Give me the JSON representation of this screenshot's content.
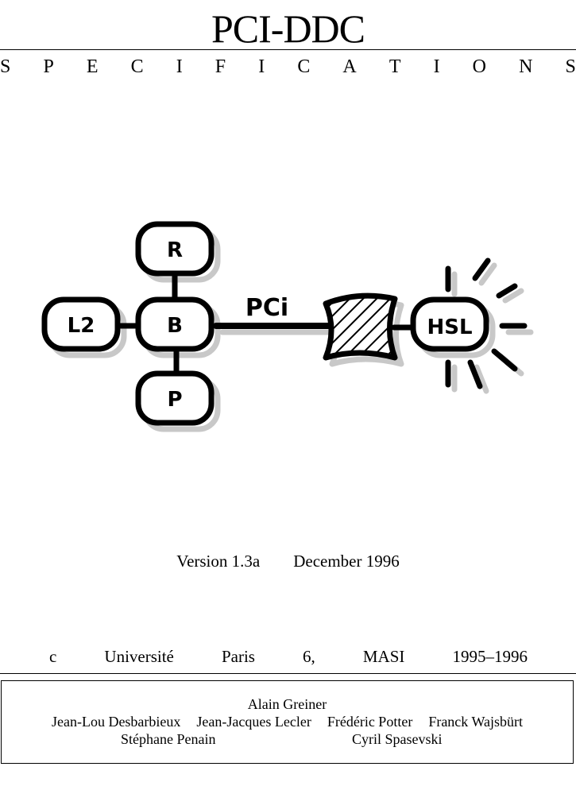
{
  "document": {
    "title": "PCI-DDC",
    "subtitle_letters": [
      "S",
      "P",
      "E",
      "C",
      "I",
      "F",
      "I",
      "C",
      "A",
      "T",
      "I",
      "O",
      "N",
      "S"
    ]
  },
  "diagram": {
    "blocks": [
      {
        "id": "r",
        "label": "R"
      },
      {
        "id": "b",
        "label": "B"
      },
      {
        "id": "l2",
        "label": "L2"
      },
      {
        "id": "p",
        "label": "P"
      },
      {
        "id": "hsl",
        "label": "HSL"
      }
    ],
    "bus_label": "PCi",
    "colors": {
      "stroke": "#000000",
      "shadow": "#c8c8c8",
      "fill": "#ffffff"
    }
  },
  "version": {
    "label": "Version 1.3a",
    "date": "December 1996"
  },
  "copyright": {
    "words": [
      "c",
      "Université",
      "Paris",
      "6,",
      "MASI",
      "1995–1996"
    ]
  },
  "authors": {
    "lead": "Alain Greiner",
    "row2": [
      "Jean-Lou Desbarbieux",
      "Jean-Jacques Lecler",
      "Frédéric Potter",
      "Franck Wajsbürt"
    ],
    "row3": [
      "Stéphane Penain",
      "Cyril Spasevski"
    ]
  }
}
